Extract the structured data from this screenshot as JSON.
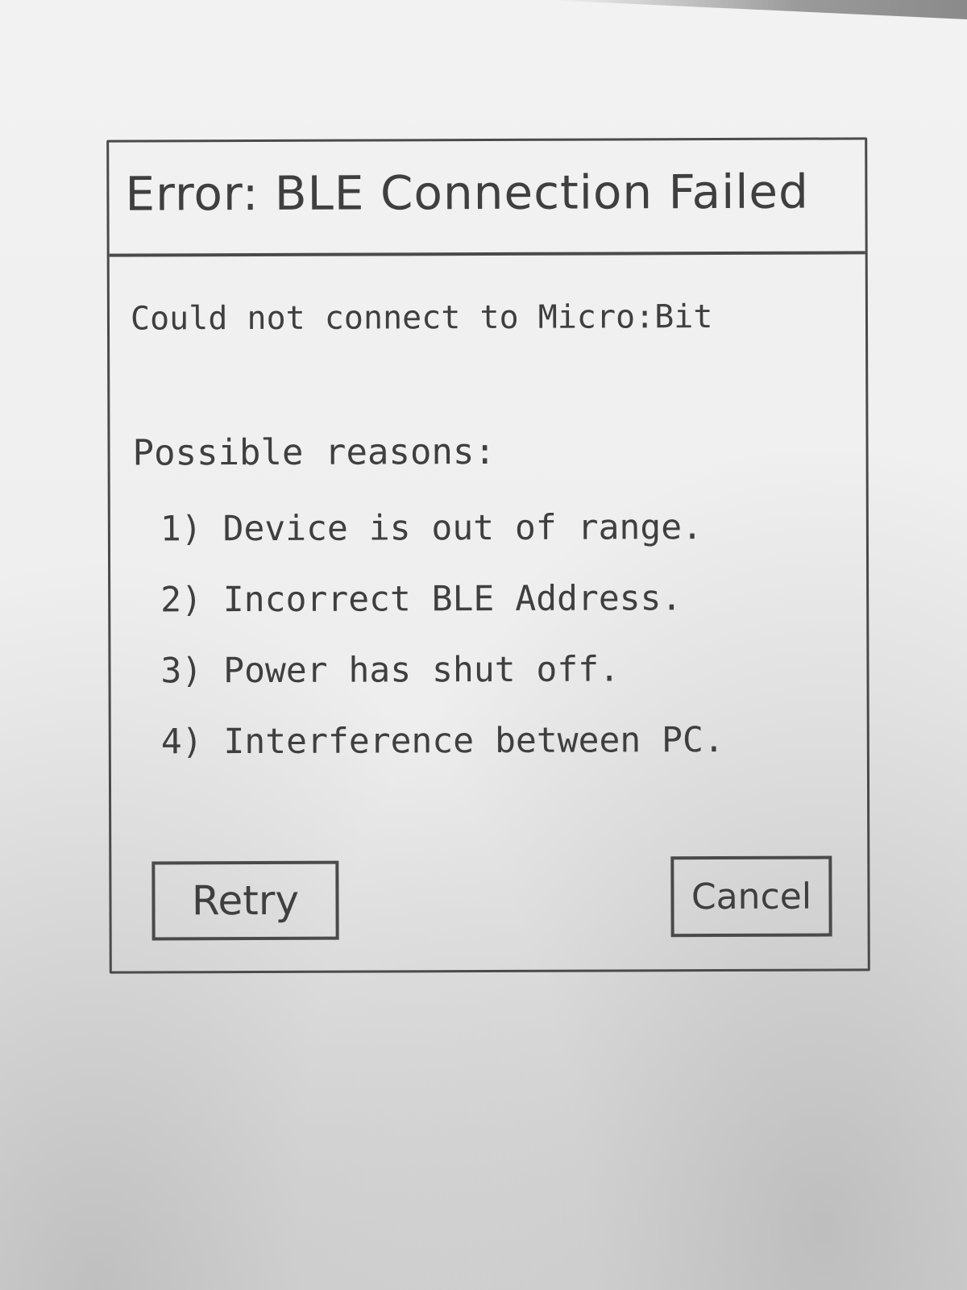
{
  "dialog": {
    "title": "Error: BLE Connection Failed",
    "message": "Could not connect to Micro:Bit",
    "reasons_heading": "Possible reasons:",
    "reasons": [
      "1) Device is out of range.",
      "2) Incorrect BLE Address.",
      "3) Power has shut off.",
      "4) Interference between PC."
    ],
    "buttons": {
      "retry_label": "Retry",
      "cancel_label": "Cancel"
    }
  }
}
